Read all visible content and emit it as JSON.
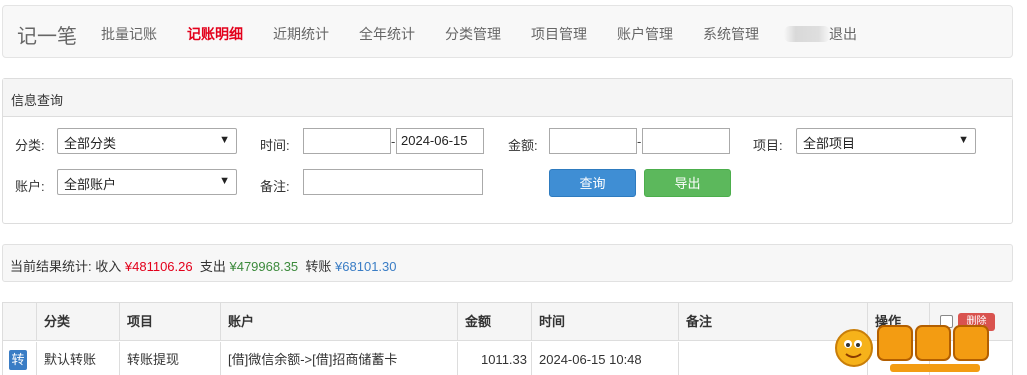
{
  "nav": {
    "brand": "记一笔",
    "items": [
      {
        "label": "批量记账"
      },
      {
        "label": "记账明细"
      },
      {
        "label": "近期统计"
      },
      {
        "label": "全年统计"
      },
      {
        "label": "分类管理"
      },
      {
        "label": "项目管理"
      },
      {
        "label": "账户管理"
      },
      {
        "label": "系统管理"
      }
    ],
    "logout": "退出"
  },
  "query": {
    "title": "信息查询",
    "category_label": "分类:",
    "category_value": "全部分类",
    "time_label": "时间:",
    "time_start": "",
    "time_end": "2024-06-15",
    "amount_label": "金额:",
    "amount_min": "",
    "amount_max": "",
    "project_label": "项目:",
    "project_value": "全部项目",
    "account_label": "账户:",
    "account_value": "全部账户",
    "note_label": "备注:",
    "note_value": "",
    "query_button": "查询",
    "export_button": "导出",
    "dash": "-"
  },
  "stats": {
    "prefix": "当前结果统计:",
    "income_label": "收入",
    "income_value": "¥481106.26",
    "expense_label": "支出",
    "expense_value": "¥479968.35",
    "transfer_label": "转账",
    "transfer_value": "¥68101.30"
  },
  "table": {
    "headers": [
      "分类",
      "项目",
      "账户",
      "金额",
      "时间",
      "备注",
      "操作"
    ],
    "delete_label": "删除",
    "rows": [
      {
        "type_badge": "转",
        "category": "默认转账",
        "project": "转账提现",
        "account": "[借]微信余额->[借]招商储蓄卡",
        "amount": "1011.33",
        "time": "2024-06-15 10:48",
        "note": ""
      }
    ]
  },
  "colors": {
    "active_nav": "#e3001b",
    "income": "#e3001b",
    "expense": "#3c8a3c",
    "transfer": "#3a7dc5",
    "query_button": "#3f8ed4",
    "export_button": "#5cb85c"
  }
}
